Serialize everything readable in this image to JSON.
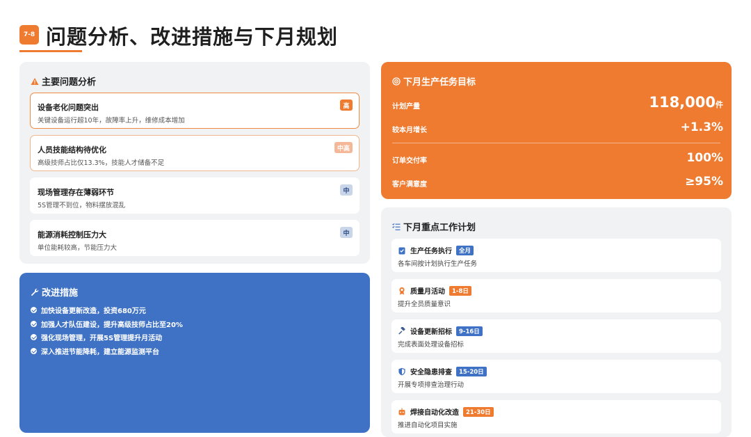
{
  "header": {
    "badge": "7-8",
    "title": "问题分析、改进措施与下月规划"
  },
  "problems": {
    "title": "主要问题分析",
    "items": [
      {
        "title": "设备老化问题突出",
        "desc": "关键设备运行超10年，故障率上升，维修成本增加",
        "level": "高"
      },
      {
        "title": "人员技能结构待优化",
        "desc": "高级技师占比仅13.3%，技能人才储备不足",
        "level": "中高"
      },
      {
        "title": "现场管理存在薄弱环节",
        "desc": "5S管理不到位，物料摆放混乱",
        "level": "中"
      },
      {
        "title": "能源消耗控制压力大",
        "desc": "单位能耗较高，节能压力大",
        "level": "中"
      }
    ]
  },
  "measures": {
    "title": "改进措施",
    "items": [
      "加快设备更新改造，投资680万元",
      "加强人才队伍建设，提升高级技师占比至20%",
      "强化现场管理，开展5S管理提升月活动",
      "深入推进节能降耗，建立能源监测平台"
    ]
  },
  "targets": {
    "title": "下月生产任务目标",
    "output_label": "计划产量",
    "output_value": "118,000",
    "output_unit": "件",
    "growth_label": "较本月增长",
    "growth_value": "+1.3%",
    "delivery_label": "订单交付率",
    "delivery_value": "100%",
    "satisfaction_label": "客户满意度",
    "satisfaction_value": "≥95%"
  },
  "plan": {
    "title": "下月重点工作计划",
    "items": [
      {
        "name": "生产任务执行",
        "tag": "全月",
        "tag_color": "blue",
        "desc": "各车间按计划执行生产任务",
        "icon": "clipboard-check-icon"
      },
      {
        "name": "质量月活动",
        "tag": "1-8日",
        "tag_color": "orange",
        "desc": "提升全员质量意识",
        "icon": "award-icon"
      },
      {
        "name": "设备更新招标",
        "tag": "9-16日",
        "tag_color": "blue",
        "desc": "完成表面处理设备招标",
        "icon": "gavel-icon"
      },
      {
        "name": "安全隐患排查",
        "tag": "15-20日",
        "tag_color": "blue",
        "desc": "开展专项排查治理行动",
        "icon": "shield-icon"
      },
      {
        "name": "焊接自动化改造",
        "tag": "21-30日",
        "tag_color": "orange",
        "desc": "推进自动化项目实施",
        "icon": "robot-icon"
      }
    ]
  },
  "colors": {
    "accent_orange": "#ee7b30",
    "accent_blue": "#3f72c4",
    "card_gray": "#f1f2f4"
  }
}
